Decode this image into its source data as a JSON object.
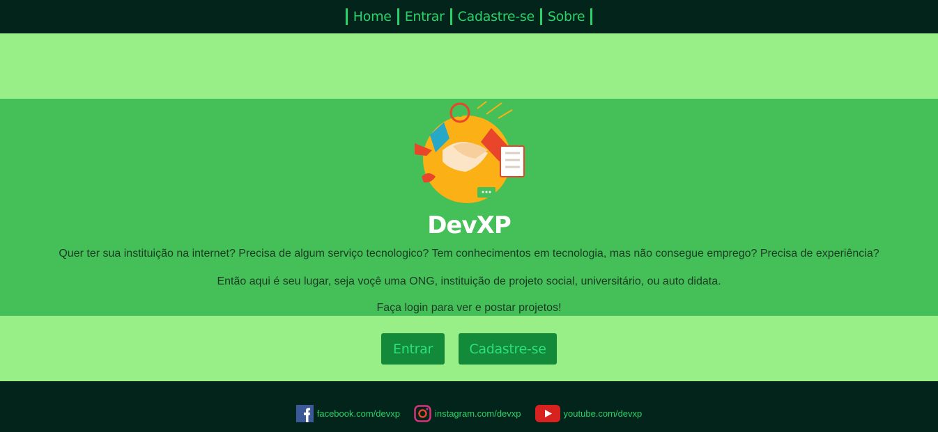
{
  "nav": {
    "items": [
      {
        "label": "Home"
      },
      {
        "label": "Entrar"
      },
      {
        "label": "Cadastre-se"
      },
      {
        "label": "Sobre"
      }
    ]
  },
  "hero": {
    "brand": "DevXP",
    "line1": "Quer ter sua instituição na internet? Precisa de algum serviço tecnologico? Tem conhecimentos em tecnologia, mas não consegue emprego? Precisa de experiência?",
    "line2": "Então aqui é seu lugar, seja voçê uma ONG, instituição de projeto social, universitário, ou auto didata.",
    "line3": "Faça login para ver e postar projetos!"
  },
  "actions": {
    "login_label": "Entrar",
    "signup_label": "Cadastre-se"
  },
  "footer": {
    "facebook": "facebook.com/devxp",
    "instagram": "instagram.com/devxp",
    "youtube": "youtube.com/devxp"
  },
  "colors": {
    "nav_bg": "#03241a",
    "accent": "#27d36b",
    "light_band": "#98ef88",
    "hero_bg": "#45bf58",
    "button_bg": "#138a3a"
  },
  "icons": [
    "facebook-icon",
    "instagram-icon",
    "youtube-icon",
    "handshake-illustration"
  ]
}
